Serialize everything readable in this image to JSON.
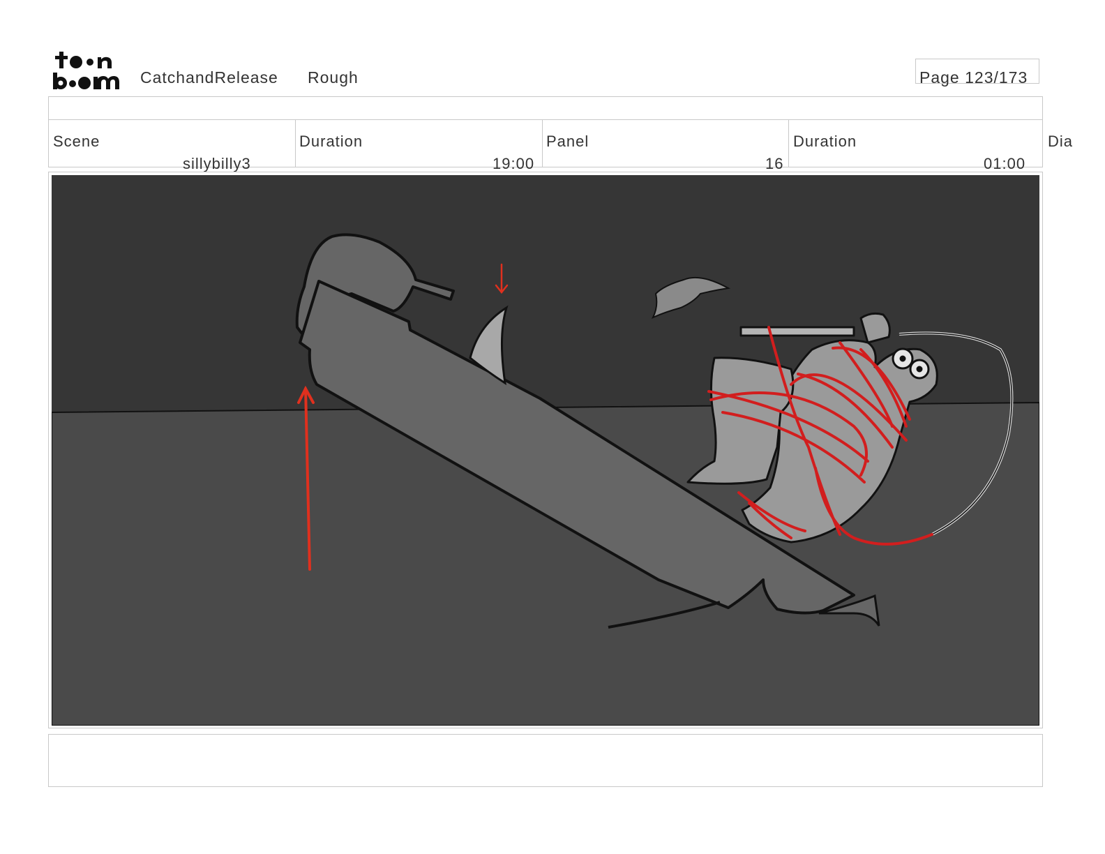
{
  "header": {
    "logo_text_top": "toon",
    "logo_text_bottom": "boom",
    "project_name": "CatchandRelease",
    "stage": "Rough",
    "page_label": "Page 123/173"
  },
  "fields": {
    "scene_label": "Scene",
    "scene_value": "sillybilly3",
    "scene_duration_label": "Duration",
    "scene_duration_value": "19:00",
    "panel_label": "Panel",
    "panel_value": "16",
    "panel_duration_label": "Duration",
    "panel_duration_value": "01:00",
    "dialogue_label": "Dia"
  },
  "colors": {
    "sky": "#363636",
    "water": "#4a4a4a",
    "boat": "#666666",
    "figure": "#9a9a9a",
    "annotation_red": "#e0301e",
    "outline": "#111111",
    "border": "#c8c8c8"
  },
  "notes": ""
}
